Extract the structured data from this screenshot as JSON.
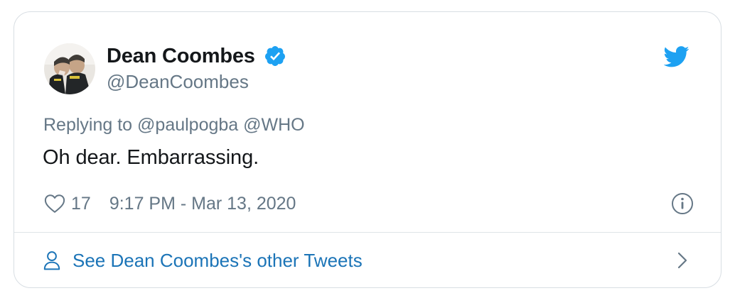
{
  "tweet": {
    "author": {
      "display_name": "Dean Coombes",
      "handle": "@DeanCoombes",
      "verified": true
    },
    "reply_prefix": "Replying to",
    "reply_mentions": [
      "@paulpogba",
      "@WHO"
    ],
    "text": "Oh dear. Embarrassing.",
    "like_count": "17",
    "timestamp": "9:17 PM - Mar 13, 2020"
  },
  "footer": {
    "label": "See Dean Coombes's other Tweets"
  },
  "icons": {
    "verified": "verified-badge-icon",
    "brand": "twitter-bird-icon",
    "like": "heart-outline-icon",
    "info": "info-circle-icon",
    "person": "person-outline-icon",
    "chevron": "chevron-right-icon"
  },
  "colors": {
    "twitter_blue": "#1da1f2",
    "link_blue": "#1b74b7",
    "secondary_text": "#657786",
    "primary_text": "#14171a",
    "border": "#d8dee3"
  }
}
